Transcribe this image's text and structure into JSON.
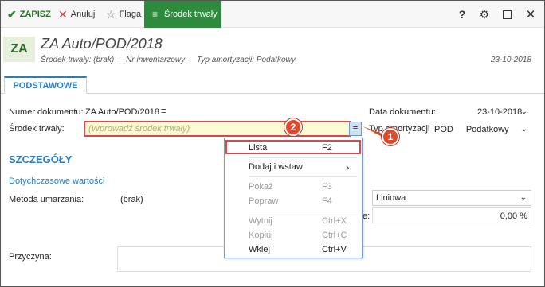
{
  "toolbar": {
    "save": "ZAPISZ",
    "cancel": "Anuluj",
    "flag": "Flaga",
    "fixed_asset": "Środek trwały",
    "help": "?",
    "settings_icon": "gear-icon",
    "maximize_icon": "maximize-icon",
    "close_icon": "close-icon"
  },
  "header": {
    "badge": "ZA",
    "title": "ZA Auto/POD/2018",
    "subtitle_asset": "Środek trwały: (brak)",
    "subtitle_inv": "Nr inwentarzowy",
    "subtitle_type": "Typ amortyzacji: Podatkowy",
    "sep": "·",
    "date": "23-10-2018"
  },
  "tabs": [
    "PODSTAWOWE"
  ],
  "form": {
    "doc_number_label": "Numer dokumentu:",
    "doc_number_value": "ZA Auto/POD/2018",
    "doc_number_menu": "≡",
    "doc_date_label": "Data dokumentu:",
    "doc_date_value": "23-10-2018",
    "asset_label": "Środek trwały:",
    "asset_placeholder": "(Wprowadź środek trwały)",
    "asset_menu": "≡",
    "amort_label": "Typ amortyzacji:",
    "amort_code": "POD",
    "amort_value": "Podatkowy"
  },
  "details": {
    "section_title": "SZCZEGÓŁY",
    "subsection": "Dotychczasowe wartości",
    "method_label": "Metoda umarzania:",
    "method_value": "(brak)",
    "method_right": "Liniowa",
    "rate_label_tail": "e:",
    "rate_value": "0,00 %",
    "reason_label": "Przyczyna:"
  },
  "dropdown": {
    "items": [
      {
        "label": "Lista",
        "shortcut": "F2",
        "enabled": true
      },
      {
        "label": "Dodaj i wstaw",
        "shortcut": "›",
        "enabled": true
      },
      {
        "label": "Pokaż",
        "shortcut": "F3",
        "enabled": false
      },
      {
        "label": "Popraw",
        "shortcut": "F4",
        "enabled": false
      },
      {
        "label": "Wytnij",
        "shortcut": "Ctrl+X",
        "enabled": false
      },
      {
        "label": "Kopiuj",
        "shortcut": "Ctrl+C",
        "enabled": false
      },
      {
        "label": "Wklej",
        "shortcut": "Ctrl+V",
        "enabled": true
      }
    ]
  },
  "callouts": [
    "1",
    "2"
  ],
  "colors": {
    "accent": "#2a7dc1",
    "toolbar_green": "#2e8b3e",
    "callout": "#e04a2c",
    "highlight": "#d94a4a",
    "input_bg": "#fcfbd3"
  }
}
